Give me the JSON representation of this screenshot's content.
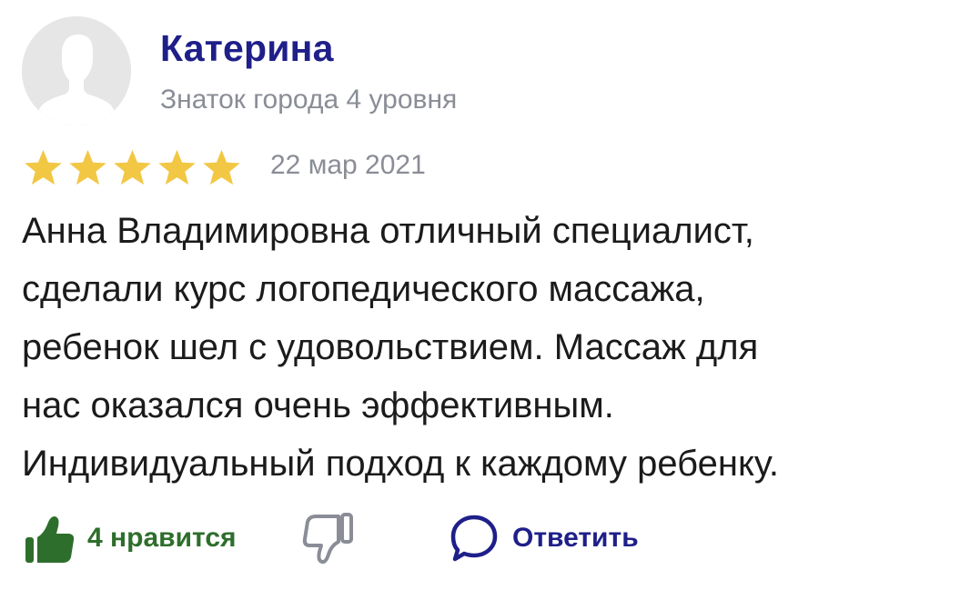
{
  "review": {
    "author": {
      "name": "Катерина",
      "level": "Знаток города 4 уровня",
      "avatar_icon": "default-user-silhouette-icon"
    },
    "rating": {
      "stars": 5,
      "max": 5,
      "star_color": "#f2c744"
    },
    "date": "22 мар 2021",
    "text_lines": [
      "Анна Владимировна отличный специалист,",
      "сделали курс логопедического массажа,",
      "ребенок шел с удовольствием. Массаж для",
      "нас оказался очень эффективным.",
      "Индивидуальный подход к каждому ребенку."
    ],
    "actions": {
      "like_label": "4 нравится",
      "like_icon": "thumbs-up-filled-icon",
      "dislike_icon": "thumbs-down-outline-icon",
      "reply_label": "Ответить",
      "reply_icon": "speech-bubble-icon"
    },
    "colors": {
      "name": "#1f1f8a",
      "meta": "#8a8d96",
      "like": "#2e6e2c",
      "reply": "#1f1f8a",
      "text": "#1b1b1b"
    }
  }
}
